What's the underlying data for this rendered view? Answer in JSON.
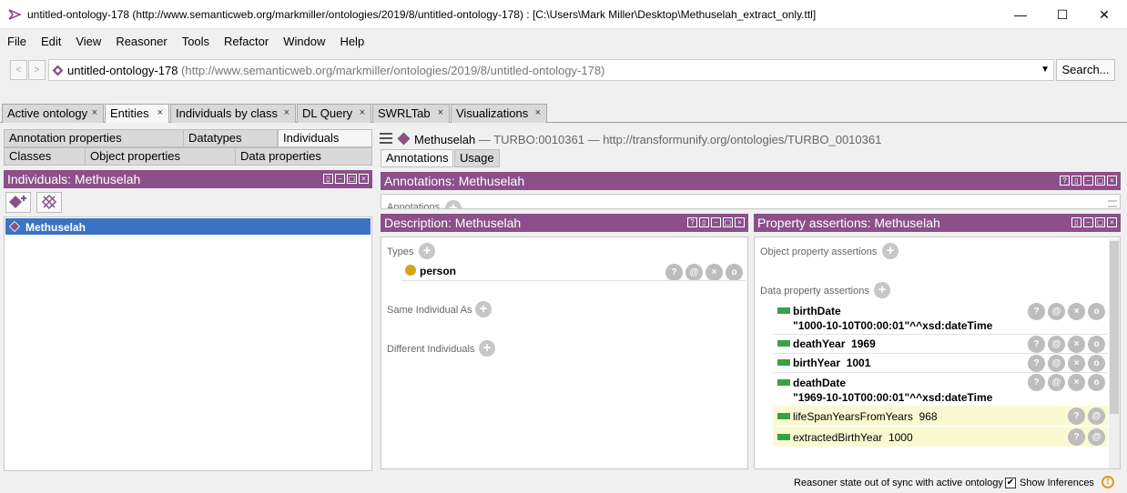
{
  "window": {
    "title": "untitled-ontology-178 (http://www.semanticweb.org/markmiller/ontologies/2019/8/untitled-ontology-178)  : [C:\\Users\\Mark Miller\\Desktop\\Methuselah_extract_only.ttl]",
    "minimize": "—",
    "maximize": "☐",
    "close": "✕"
  },
  "menu": [
    "File",
    "Edit",
    "View",
    "Reasoner",
    "Tools",
    "Refactor",
    "Window",
    "Help"
  ],
  "address": {
    "back": "<",
    "forward": ">",
    "ontology_name": "untitled-ontology-178",
    "ontology_iri": "(http://www.semanticweb.org/markmiller/ontologies/2019/8/untitled-ontology-178)",
    "search_label": "Search..."
  },
  "tabs": [
    {
      "label": "Active ontology",
      "close": "×"
    },
    {
      "label": "Entities",
      "close": "×"
    },
    {
      "label": "Individuals by class",
      "close": "×"
    },
    {
      "label": "DL Query",
      "close": "×"
    },
    {
      "label": "SWRLTab",
      "close": "×"
    },
    {
      "label": "Visualizations",
      "close": "×"
    }
  ],
  "left": {
    "subtabs_row1": [
      "Annotation properties",
      "Datatypes",
      "Individuals"
    ],
    "subtabs_row2": [
      "Classes",
      "Object properties",
      "Data properties"
    ],
    "panel_title": "Individuals: Methuselah",
    "selected_individual": "Methuselah"
  },
  "entity_header": {
    "name": "Methuselah",
    "sep1": " — ",
    "id": "TURBO:0010361",
    "sep2": " — ",
    "iri": "http://transformunify.org/ontologies/TURBO_0010361"
  },
  "entity_tabs": [
    "Annotations",
    "Usage"
  ],
  "annotations": {
    "title": "Annotations: Methuselah",
    "label": "Annotations"
  },
  "description": {
    "title": "Description: Methuselah",
    "types_label": "Types",
    "type_value": "person",
    "same_label": "Same Individual As",
    "different_label": "Different Individuals"
  },
  "property_assertions": {
    "title": "Property assertions: Methuselah",
    "object_label": "Object property assertions",
    "data_label": "Data property assertions",
    "asserted": [
      {
        "prop": "birthDate",
        "value": "\"1000-10-10T00:00:01\"^^xsd:dateTime"
      },
      {
        "prop": "deathYear",
        "value": "1969"
      },
      {
        "prop": "birthYear",
        "value": "1001"
      },
      {
        "prop": "deathDate",
        "value": "\"1969-10-10T00:00:01\"^^xsd:dateTime"
      }
    ],
    "inferred": [
      {
        "prop": "lifeSpanYearsFromYears",
        "value": "968"
      },
      {
        "prop": "extractedBirthYear",
        "value": "1000"
      }
    ]
  },
  "buttons": {
    "help": "?",
    "at": "@",
    "remove": "×",
    "edit": "o"
  },
  "status": {
    "message": "Reasoner state out of sync with active ontology",
    "show_inferences": "Show Inferences",
    "checked": "✔",
    "warning": "!"
  },
  "colors": {
    "panel_header": "#8b5089",
    "selection": "#3b73c4",
    "green": "#3aa04a",
    "inferred_bg": "#fafad2",
    "class_icon": "#d6a417"
  }
}
